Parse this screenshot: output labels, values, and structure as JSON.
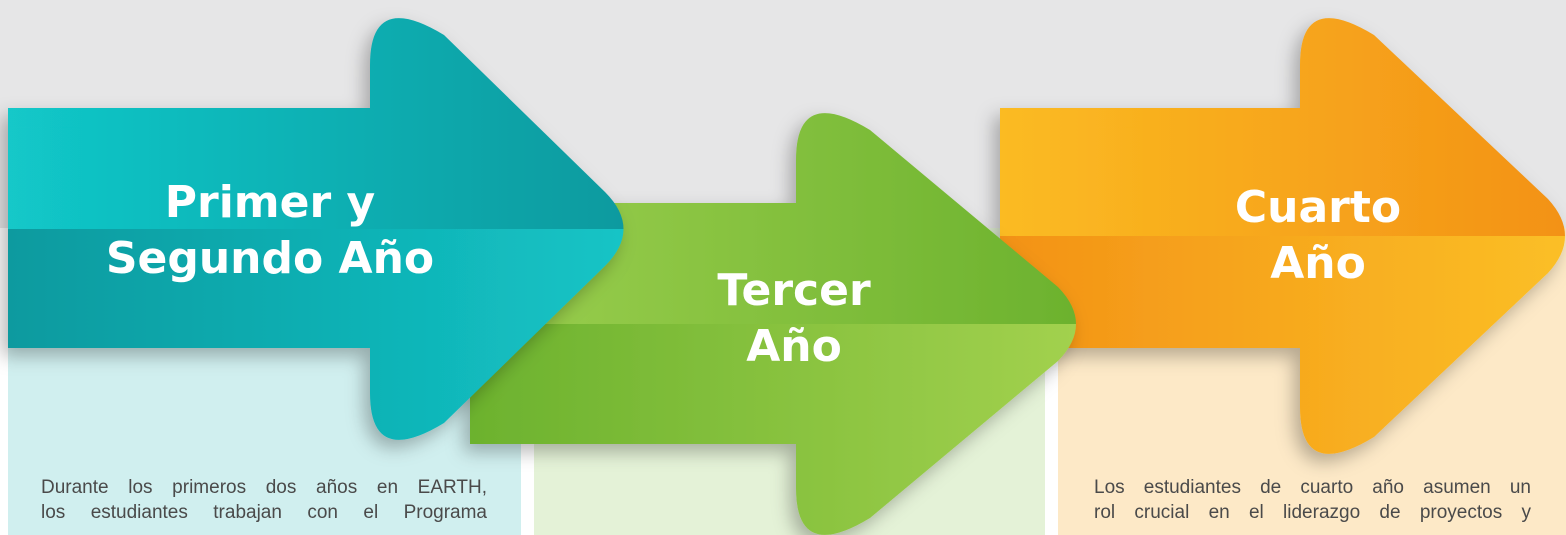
{
  "colors": {
    "background_band": "#e6e6e7",
    "panel_teal": "#d0efef",
    "panel_green": "#e4f2d7",
    "panel_orange": "#fde9c7",
    "arrow_teal": "#0fb3b6",
    "arrow_green": "#7dbd3a",
    "arrow_orange": "#f7a11c"
  },
  "stages": [
    {
      "title_line1": "Primer y",
      "title_line2": "Segundo Año",
      "description_line1": "Durante los primeros dos años en EARTH,",
      "description_line2": "los estudiantes trabajan con el Programa"
    },
    {
      "title_line1": "Tercer",
      "title_line2": "Año"
    },
    {
      "title_line1": "Cuarto",
      "title_line2": "Año",
      "description_line1": "Los estudiantes de cuarto año asumen un",
      "description_line2": "rol crucial en el liderazgo de proyectos y"
    }
  ]
}
